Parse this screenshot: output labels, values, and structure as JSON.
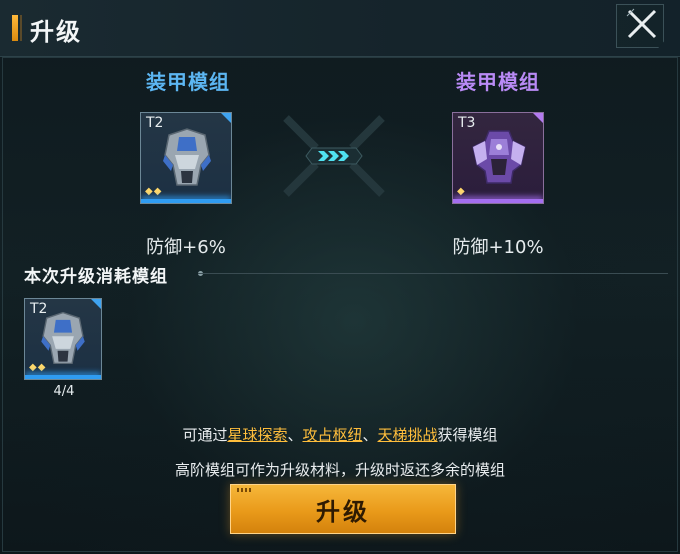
{
  "header": {
    "title": "升级"
  },
  "current_module": {
    "name": "装甲模组",
    "name_color": "#5cb6f2",
    "tier": "T2",
    "rarity_color": "#2f9cf2",
    "stars": "◆◆",
    "stat": "防御+6%"
  },
  "next_module": {
    "name": "装甲模组",
    "name_color": "#b98af5",
    "tier": "T3",
    "rarity_color": "#a46ef0",
    "stars": "◆",
    "stat": "防御+10%"
  },
  "cost_section": {
    "title": "本次升级消耗模组",
    "items": [
      {
        "tier": "T2",
        "stars": "◆◆",
        "count": "4/4"
      }
    ]
  },
  "hints": {
    "line1_prefix": "可通过",
    "link1": "星球探索",
    "sep1": "、",
    "link2": "攻占枢纽",
    "sep2": "、",
    "link3": "天梯挑战",
    "line1_suffix": "获得模组",
    "line2": "高阶模组可作为升级材料，升级时返还多余的模组"
  },
  "actions": {
    "upgrade_label": "升级"
  },
  "colors": {
    "accent_orange": "#ffbe3c",
    "button_gold": "#e99a1a"
  },
  "icons": {
    "close": "close-x-icon",
    "arrow": "chevron-right-arrows-icon",
    "item": "armor-module-icon"
  }
}
